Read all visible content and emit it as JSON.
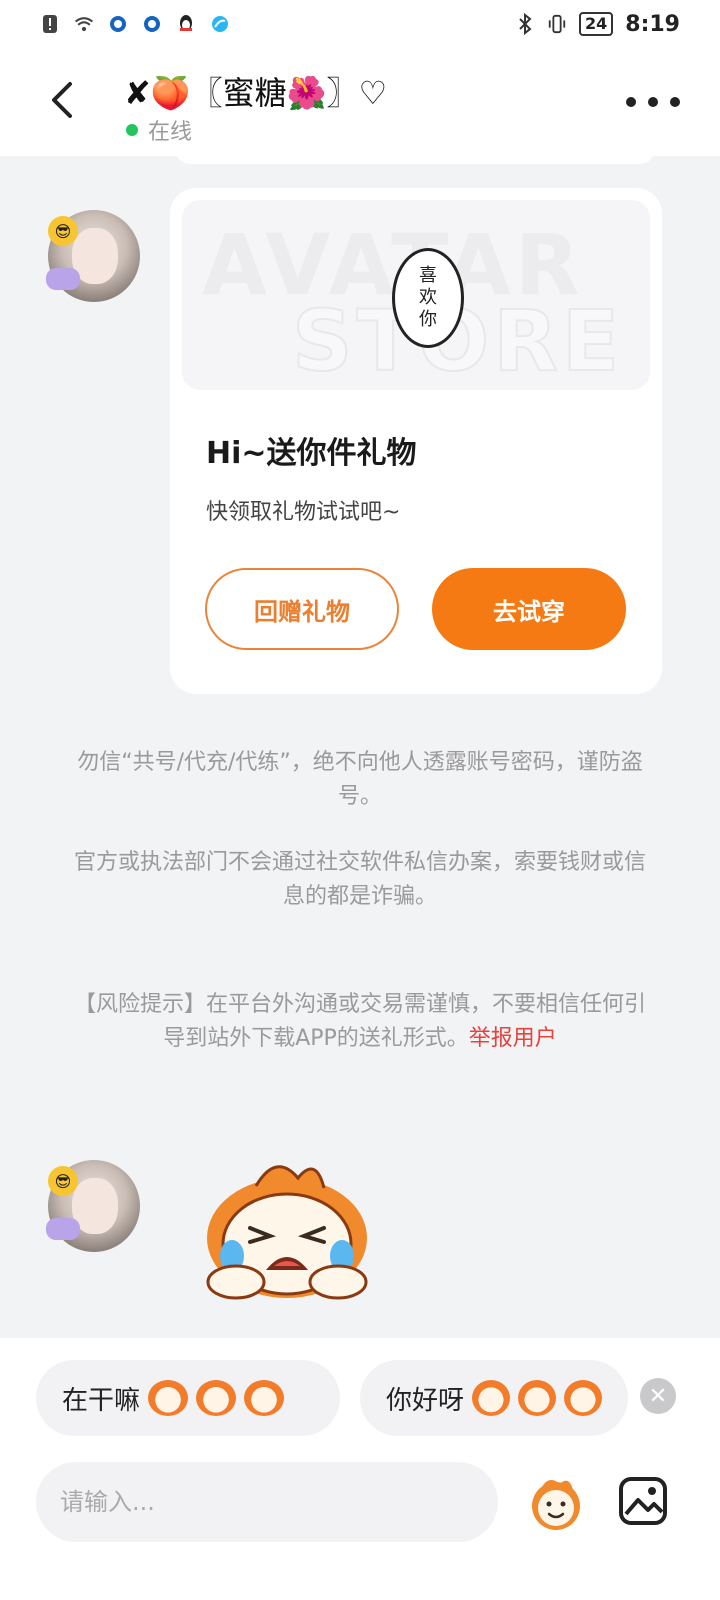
{
  "status_bar": {
    "battery": "24",
    "time": "8:19"
  },
  "header": {
    "title": "✘🍑〖蜜糖🌺〗♡",
    "status": "在线"
  },
  "gift_card": {
    "banner_text_1": "AVATAR",
    "banner_text_2": "STORE",
    "bubble_lines": [
      "喜",
      "欢",
      "你"
    ],
    "title": "Hi~送你件礼物",
    "subtitle": "快领取礼物试试吧~",
    "button_return": "回赠礼物",
    "button_try": "去试穿"
  },
  "notices": {
    "line1": "勿信“共号/代充/代练”，绝不向他人透露账号密码，谨防盗号。",
    "line2": "官方或执法部门不会通过社交软件私信办案，索要钱财或信息的都是诈骗。",
    "line3": "【风险提示】在平台外沟通或交易需谨慎，不要相信任何引导到站外下载APP的送礼形式。",
    "report_link": "举报用户"
  },
  "quick_replies": [
    {
      "text": "在干嘛"
    },
    {
      "text": "你好呀"
    }
  ],
  "input": {
    "placeholder": "请输入..."
  },
  "colors": {
    "accent": "#f57a14",
    "online": "#22c55e",
    "report": "#e8423c"
  }
}
